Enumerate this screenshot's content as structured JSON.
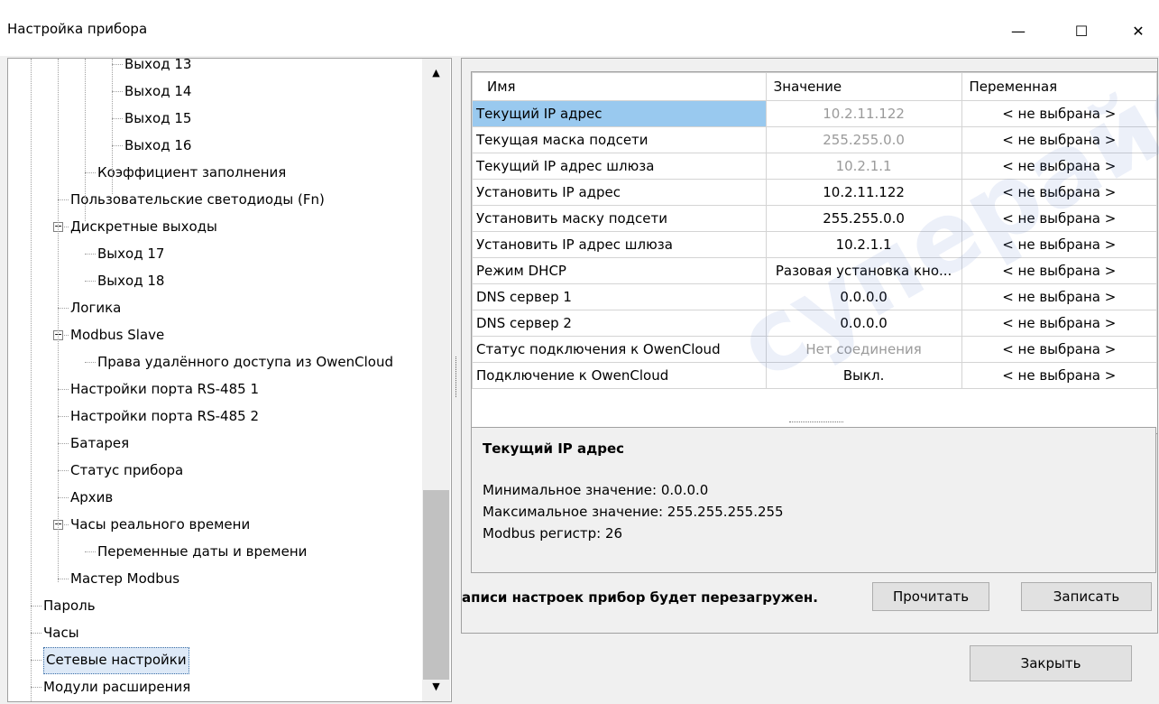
{
  "window": {
    "title": "Настройка прибора",
    "minimize_glyph": "—",
    "maximize_glyph": "☐",
    "close_glyph": "✕"
  },
  "tree": {
    "items": [
      {
        "label": "Выход 13",
        "level": 3
      },
      {
        "label": "Выход 14",
        "level": 3
      },
      {
        "label": "Выход 15",
        "level": 3
      },
      {
        "label": "Выход 16",
        "level": 3
      },
      {
        "label": "Коэффициент заполнения",
        "level": 2
      },
      {
        "label": "Пользовательские светодиоды (Fn)",
        "level": 1
      },
      {
        "label": "Дискретные выходы",
        "level": 1,
        "expander": "−"
      },
      {
        "label": "Выход 17",
        "level": 2
      },
      {
        "label": "Выход 18",
        "level": 2
      },
      {
        "label": "Логика",
        "level": 1
      },
      {
        "label": "Modbus Slave",
        "level": 1,
        "expander": "−"
      },
      {
        "label": "Права удалённого доступа из OwenCloud",
        "level": 2
      },
      {
        "label": "Настройки порта RS-485 1",
        "level": 1
      },
      {
        "label": "Настройки порта RS-485 2",
        "level": 1
      },
      {
        "label": "Батарея",
        "level": 1
      },
      {
        "label": "Статус прибора",
        "level": 1
      },
      {
        "label": "Архив",
        "level": 1
      },
      {
        "label": "Часы реального времени",
        "level": 1,
        "expander": "−"
      },
      {
        "label": "Переменные даты и времени",
        "level": 2
      },
      {
        "label": "Мастер Modbus",
        "level": 1
      },
      {
        "label": "Пароль",
        "level": 0
      },
      {
        "label": "Часы",
        "level": 0
      },
      {
        "label": "Сетевые настройки",
        "level": 0,
        "selected": true
      },
      {
        "label": "Модули расширения",
        "level": 0
      }
    ],
    "scroll_up_glyph": "▲",
    "scroll_down_glyph": "▼"
  },
  "grid": {
    "headers": [
      "Имя",
      "Значение",
      "Переменная"
    ],
    "rows": [
      {
        "name": "Текущий IP адрес",
        "value": "10.2.11.122",
        "variable": "< не выбрана >",
        "readonly": true,
        "selected": true
      },
      {
        "name": "Текущая маска подсети",
        "value": "255.255.0.0",
        "variable": "< не выбрана >",
        "readonly": true
      },
      {
        "name": "Текущий IP адрес шлюза",
        "value": "10.2.1.1",
        "variable": "< не выбрана >",
        "readonly": true
      },
      {
        "name": "Установить IP адрес",
        "value": "10.2.11.122",
        "variable": "< не выбрана >"
      },
      {
        "name": "Установить маску подсети",
        "value": "255.255.0.0",
        "variable": "< не выбрана >"
      },
      {
        "name": "Установить IP адрес шлюза",
        "value": "10.2.1.1",
        "variable": "< не выбрана >"
      },
      {
        "name": "Режим DHCP",
        "value": "Разовая установка кно...",
        "variable": "< не выбрана >"
      },
      {
        "name": "DNS сервер 1",
        "value": "0.0.0.0",
        "variable": "< не выбрана >"
      },
      {
        "name": "DNS сервер 2",
        "value": "0.0.0.0",
        "variable": "< не выбрана >"
      },
      {
        "name": "Статус подключения к OwenCloud",
        "value": "Нет соединения",
        "variable": "< не выбрана >",
        "readonly": true
      },
      {
        "name": "Подключение к OwenCloud",
        "value": "Выкл.",
        "variable": "< не выбрана >"
      }
    ]
  },
  "description": {
    "title": "Текущий IP адрес",
    "lines": [
      "Минимальное значение: 0.0.0.0",
      "Максимальное значение: 255.255.255.255",
      "Modbus регистр: 26"
    ]
  },
  "footer": {
    "note": "аписи настроек прибор будет перезагружен.",
    "read_button": "Прочитать",
    "write_button": "Записать",
    "close_button": "Закрыть"
  },
  "watermark": {
    "text": "суперайс",
    "color": "#466ec8"
  }
}
